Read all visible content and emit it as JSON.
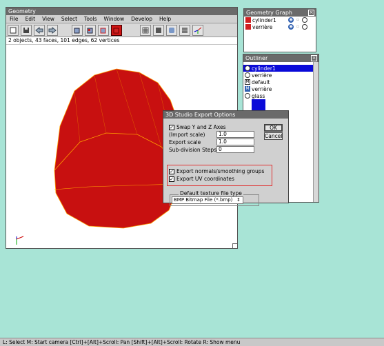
{
  "geometry_window": {
    "title": "Geometry",
    "menu": [
      "File",
      "Edit",
      "View",
      "Select",
      "Tools",
      "Window",
      "Develop",
      "Help"
    ],
    "stats": "2 objects, 43 faces, 101 edges, 62 vertices",
    "model_color": "#c81010",
    "edge_color": "#ffb000"
  },
  "geometry_graph": {
    "title": "Geometry Graph",
    "items": [
      "cylinder1",
      "verrière"
    ]
  },
  "outliner": {
    "title": "Outliner",
    "items": [
      {
        "label": "cylinder1",
        "icon": "object-icon",
        "selected": true
      },
      {
        "label": "verrière",
        "icon": "object-icon",
        "selected": false
      },
      {
        "label": "default",
        "icon": "material-icon",
        "selected": false
      },
      {
        "label": "verrière",
        "icon": "material-icon",
        "selected": false
      },
      {
        "label": "glass",
        "icon": "material-icon",
        "selected": false
      }
    ],
    "swatch_color": "#0a0ad8"
  },
  "dialog": {
    "title": "3D Studio Export Options",
    "swap_axes": "Swap Y and Z Axes",
    "import_scale_label": "(Import scale)",
    "import_scale_value": "1.0",
    "export_scale_label": "Export scale",
    "export_scale_value": "1.0",
    "subdiv_label": "Sub-division Steps",
    "subdiv_value": "0",
    "export_normals": "Export normals/smoothing groups",
    "export_uv": "Export UV coordinates",
    "texture_group_label": "Default texture file type",
    "texture_type": "BMP Bitmap File (*.bmp)",
    "ok": "OK",
    "cancel": "Cancel"
  },
  "statusbar": {
    "text": "L: Select  M: Start camera  [Ctrl]+[Alt]+Scroll: Pan  [Shift]+[Alt]+Scroll: Rotate  R: Show menu"
  }
}
